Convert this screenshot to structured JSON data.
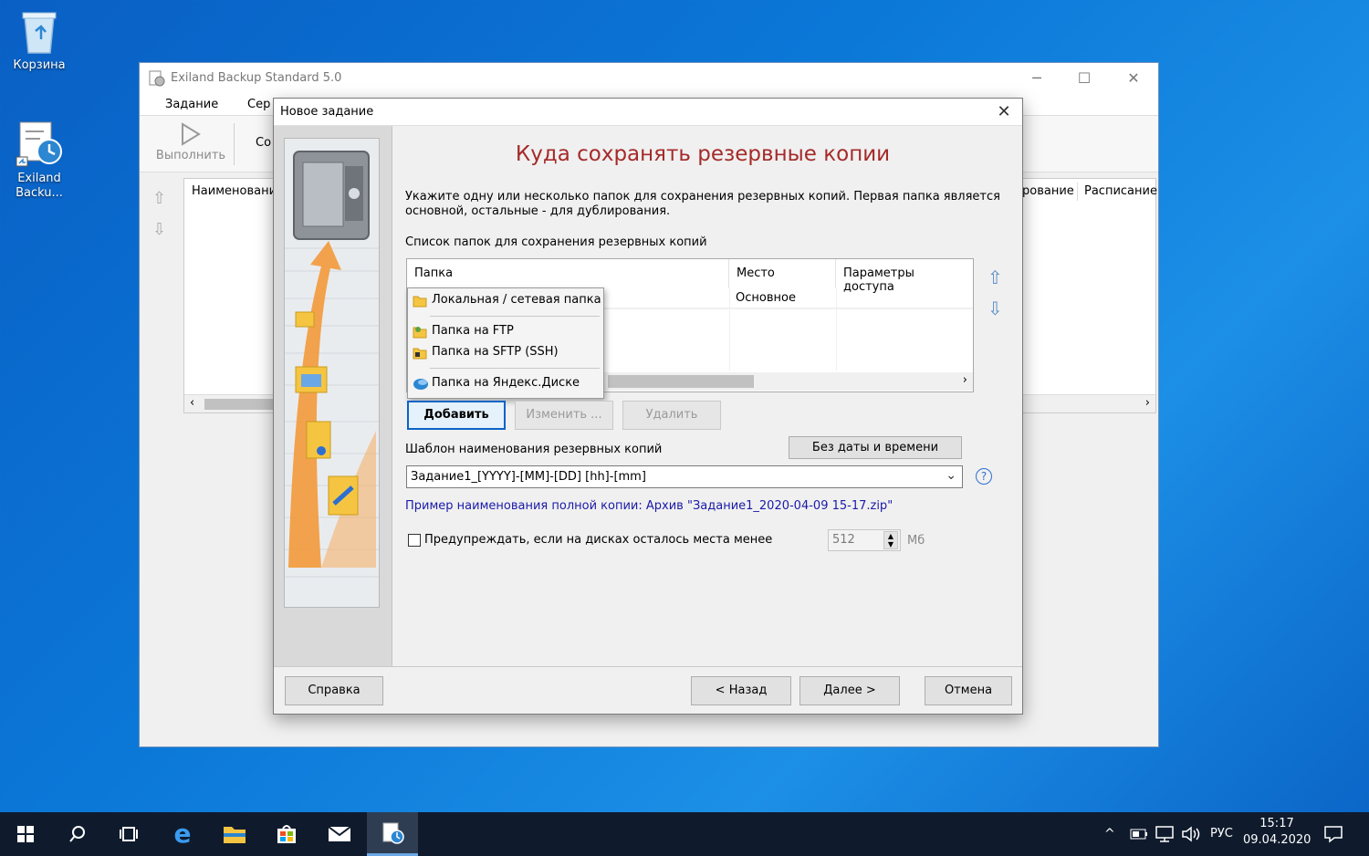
{
  "desktop": {
    "icons": [
      {
        "label": "Корзина"
      },
      {
        "label": "Exiland Backu..."
      }
    ]
  },
  "main_window": {
    "title": "Exiland Backup Standard 5.0",
    "menu": [
      "Задание",
      "Сер"
    ],
    "toolbar": {
      "run_label": "Выполнить",
      "create_label": "Со"
    },
    "list_headers": {
      "name": "Наименовани",
      "right1": "рование",
      "right2": "Расписание"
    }
  },
  "dialog": {
    "title": "Новое задание",
    "heading": "Куда сохранять резервные копии",
    "description": "Укажите одну или несколько папок для сохранения резервных копий. Первая папка является основной, остальные - для дублирования.",
    "list_label": "Список папок для сохранения резервных копий",
    "table": {
      "columns": [
        "Папка",
        "Место",
        "Параметры доступа"
      ],
      "rows": [
        {
          "place": "Основное"
        }
      ]
    },
    "add_menu": {
      "items": [
        {
          "label": "Локальная / сетевая папка",
          "icon": "folder-icon"
        },
        {
          "label": "Папка на FTP",
          "icon": "ftp-folder-icon"
        },
        {
          "label": "Папка на SFTP (SSH)",
          "icon": "sftp-folder-icon"
        },
        {
          "label": "Папка на Яндекс.Диске",
          "icon": "yandex-disk-icon"
        }
      ]
    },
    "buttons": {
      "add": "Добавить",
      "edit": "Изменить ...",
      "delete": "Удалить",
      "no_date": "Без даты и времени",
      "help": "Справка",
      "back": "< Назад",
      "next": "Далее >",
      "cancel": "Отмена"
    },
    "template_label": "Шаблон наименования резервных копий",
    "template_value": "Задание1_[YYYY]-[MM]-[DD] [hh]-[mm]",
    "example_text": "Пример наименования полной копии: Архив \"Задание1_2020-04-09 15-17.zip\"",
    "warn_label": "Предупреждать, если на дисках осталось места менее",
    "warn_checked": false,
    "warn_value": "512",
    "warn_unit": "Мб"
  },
  "taskbar": {
    "lang": "РУС",
    "time": "15:17",
    "date": "09.04.2020"
  },
  "colors": {
    "heading": "#a52a2a",
    "example": "#1a1aa8",
    "accent": "#0a63c6",
    "taskbar": "#0f1b2d"
  }
}
